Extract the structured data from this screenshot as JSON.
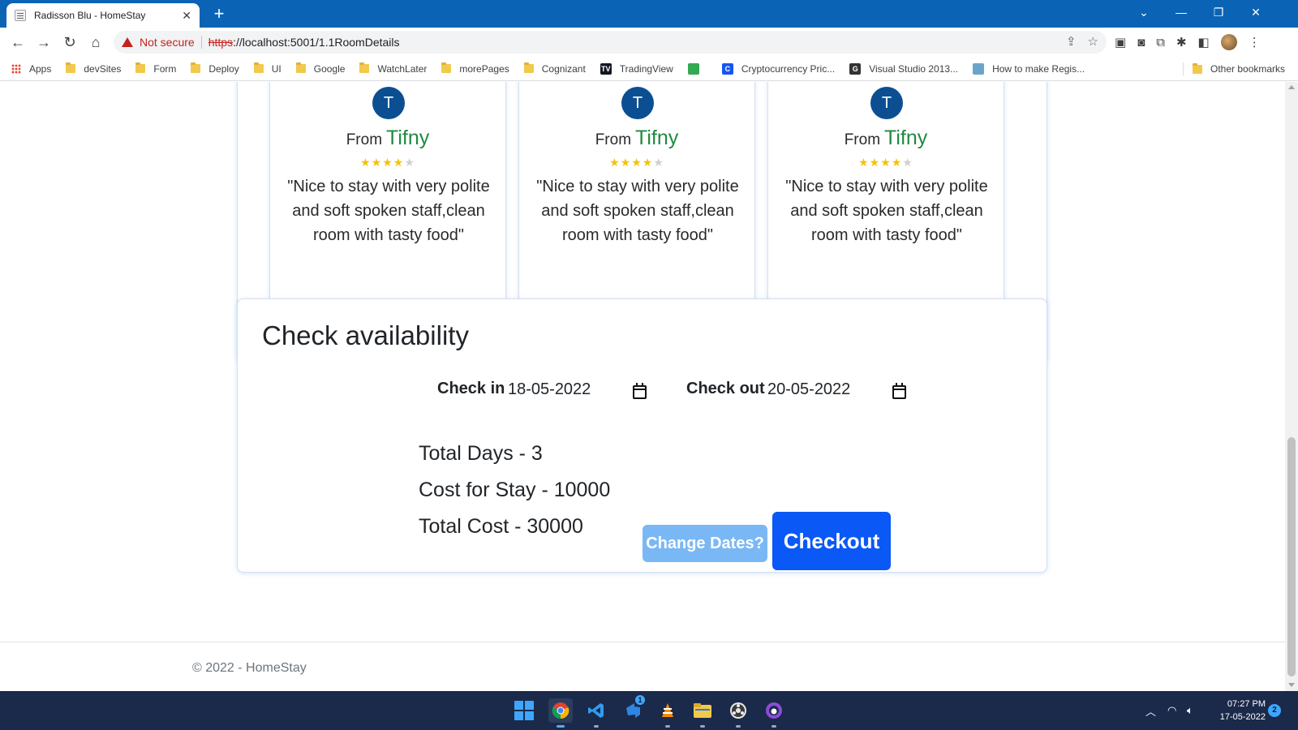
{
  "browser": {
    "tab_title": "Radisson Blu - HomeStay",
    "tab_close": "✕",
    "new_tab": "+",
    "window_controls": {
      "dropdown": "⌄",
      "minimize": "—",
      "restore": "❐",
      "close": "✕"
    },
    "security_label": "Not secure",
    "url_scheme": "https",
    "url_rest": "://localhost:5001/1.1RoomDetails",
    "bookmarks": [
      {
        "label": "Apps",
        "icon": "apps-grid"
      },
      {
        "label": "devSites",
        "icon": "folder"
      },
      {
        "label": "Form",
        "icon": "folder"
      },
      {
        "label": "Deploy",
        "icon": "folder"
      },
      {
        "label": "UI",
        "icon": "folder"
      },
      {
        "label": "Google",
        "icon": "folder"
      },
      {
        "label": "WatchLater",
        "icon": "folder"
      },
      {
        "label": "morePages",
        "icon": "folder"
      },
      {
        "label": "Cognizant",
        "icon": "folder"
      },
      {
        "label": "TradingView",
        "icon": "tradingview"
      },
      {
        "label": "",
        "icon": "analytics"
      },
      {
        "label": "Cryptocurrency Pric...",
        "icon": "coinmarketcap"
      },
      {
        "label": "Visual Studio 2013...",
        "icon": "g-site"
      },
      {
        "label": "How to make Regis...",
        "icon": "site-thumb"
      }
    ],
    "other_bookmarks": "Other bookmarks"
  },
  "reviews": {
    "cards": [
      {
        "avatar": "T",
        "from": "From",
        "name": "Tifny",
        "rating": 4,
        "max_rating": 5,
        "quote": "\"Nice to stay with very polite and soft spoken staff,clean room with tasty food\""
      },
      {
        "avatar": "T",
        "from": "From",
        "name": "Tifny",
        "rating": 4,
        "max_rating": 5,
        "quote": "\"Nice to stay with very polite and soft spoken staff,clean room with tasty food\""
      },
      {
        "avatar": "T",
        "from": "From",
        "name": "Tifny",
        "rating": 4,
        "max_rating": 5,
        "quote": "\"Nice to stay with very polite and soft spoken staff,clean room with tasty food\""
      }
    ]
  },
  "availability": {
    "title": "Check availability",
    "check_in_label": "Check in",
    "check_in_value": "18-05-2022",
    "check_out_label": "Check out",
    "check_out_value": "20-05-2022",
    "total_days": "Total Days - 3",
    "cost_for_stay": "Cost for Stay - 10000",
    "total_cost": "Total Cost - 30000",
    "change_dates_button": "Change Dates?",
    "checkout_button": "Checkout"
  },
  "footer": {
    "text": "© 2022 - HomeStay"
  },
  "taskbar": {
    "apps": [
      "start",
      "chrome",
      "vscode",
      "azure-devops",
      "vlc",
      "file-explorer",
      "obs",
      "github-desktop"
    ],
    "azure_badge": "1",
    "time": "07:27 PM",
    "date": "17-05-2022",
    "notification_count": "2"
  },
  "colors": {
    "chrome_titlebar": "#0b63b5",
    "avatar": "#0b4f92",
    "reviewer_name": "#1f8a3f",
    "star": "#f4c20d",
    "change_dates_btn": "#7ab8f5",
    "checkout_btn": "#0a58f5",
    "taskbar": "#1b2a4a"
  }
}
